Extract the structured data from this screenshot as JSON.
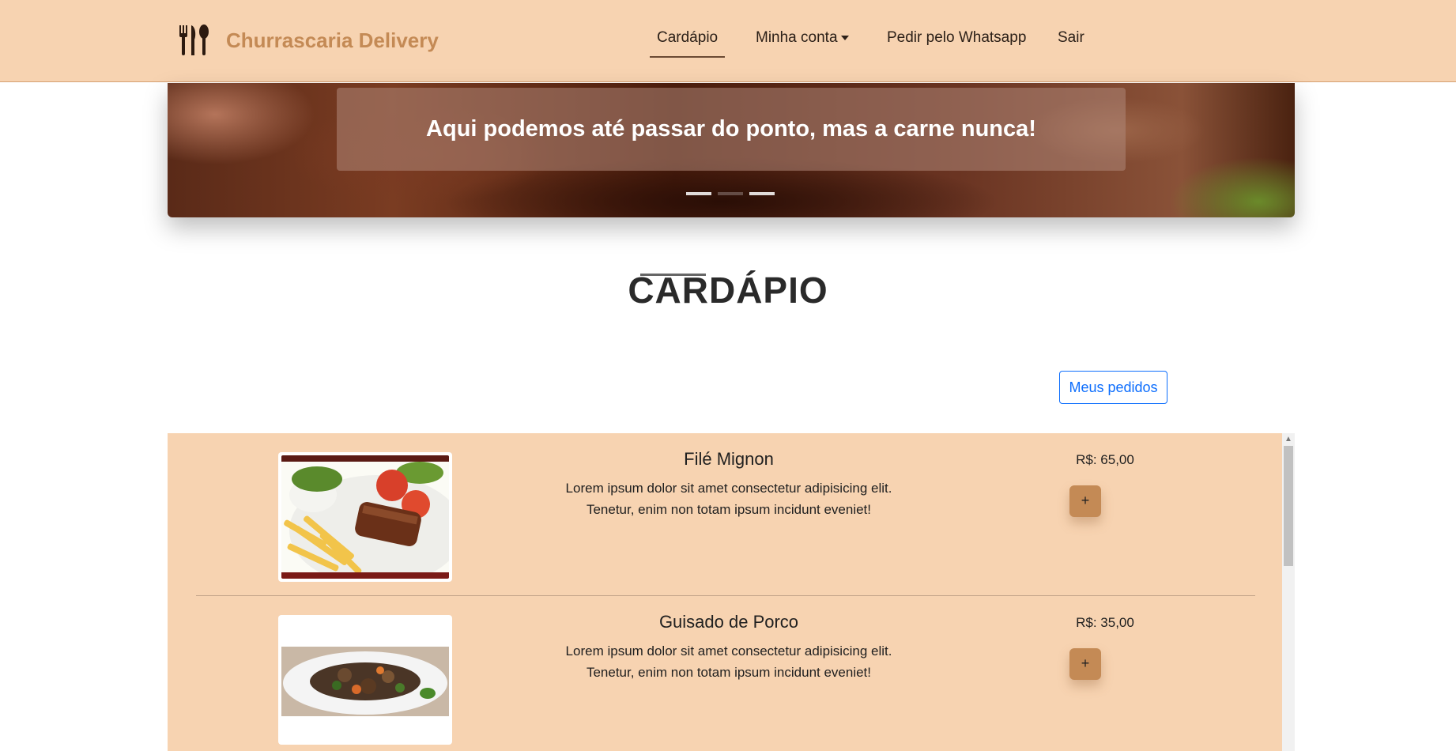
{
  "brand": {
    "name": "Churrascaria Delivery",
    "icon": "cutlery-icon"
  },
  "nav": {
    "items": [
      {
        "label": "Cardápio",
        "active": true
      },
      {
        "label": "Minha conta",
        "dropdown": true
      },
      {
        "label": "Pedir pelo Whatsapp"
      },
      {
        "label": "Sair"
      }
    ]
  },
  "hero": {
    "caption": "Aqui podemos até passar do ponto, mas a carne nunca!",
    "slide_count": 3,
    "active_slide": 2
  },
  "section": {
    "title": "CARDÁPIO"
  },
  "orders_button": {
    "label": "Meus pedidos"
  },
  "menu": {
    "items": [
      {
        "name": "Filé Mignon",
        "description": "Lorem ipsum dolor sit amet consectetur adipisicing elit. Tenetur, enim non totam ipsum incidunt eveniet!",
        "price": "R$: 65,00",
        "add_label": "+"
      },
      {
        "name": "Guisado de Porco",
        "description": "Lorem ipsum dolor sit amet consectetur adipisicing elit. Tenetur, enim non totam ipsum incidunt eveniet!",
        "price": "R$: 35,00",
        "add_label": "+"
      }
    ]
  },
  "colors": {
    "navbar": "#f7d3b1",
    "brand": "#c48a55",
    "add_button": "#c48a55",
    "primary": "#0d6efd"
  }
}
